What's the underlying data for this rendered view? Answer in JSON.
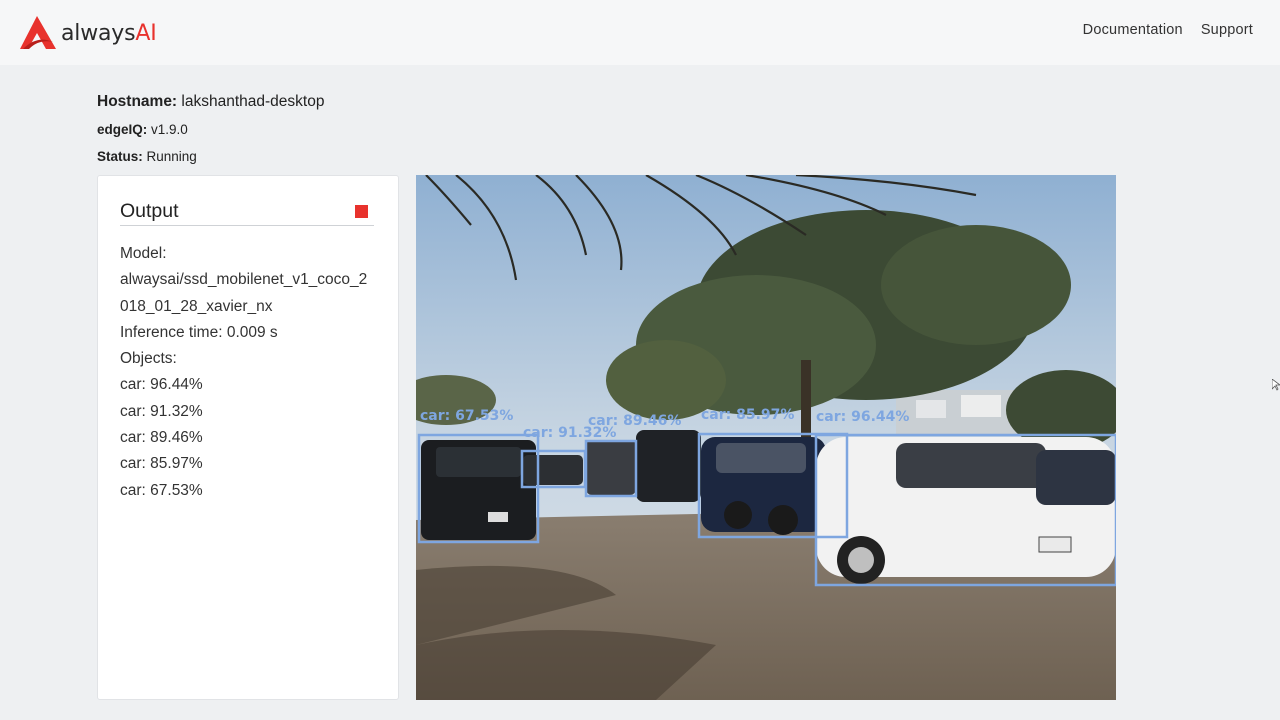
{
  "brand": {
    "name_prefix": "always",
    "name_suffix": "AI",
    "accent_color": "#e8322d"
  },
  "nav": {
    "links": [
      "Documentation",
      "Support"
    ]
  },
  "info": {
    "hostname_label": "Hostname:",
    "hostname_value": "lakshanthad-desktop",
    "edgeiq_label": "edgeIQ:",
    "edgeiq_value": "v1.9.0",
    "status_label": "Status:",
    "status_value": "Running"
  },
  "output": {
    "title": "Output",
    "model_label": "Model:",
    "model_value": "alwaysai/ssd_mobilenet_v1_coco_2018_01_28_xavier_nx",
    "inference_label": "Inference time: 0.009 s",
    "objects_label": "Objects:",
    "objects": [
      "car: 96.44%",
      "car: 91.32%",
      "car: 89.46%",
      "car: 85.97%",
      "car: 67.53%"
    ]
  },
  "video": {
    "box_color": "#7ea6e0",
    "detections": [
      {
        "label": "car: 67.53%"
      },
      {
        "label": "car: 91.32%"
      },
      {
        "label": "car: 89.46%"
      },
      {
        "label": "car: 85.97%"
      },
      {
        "label": "car: 96.44%"
      }
    ]
  }
}
